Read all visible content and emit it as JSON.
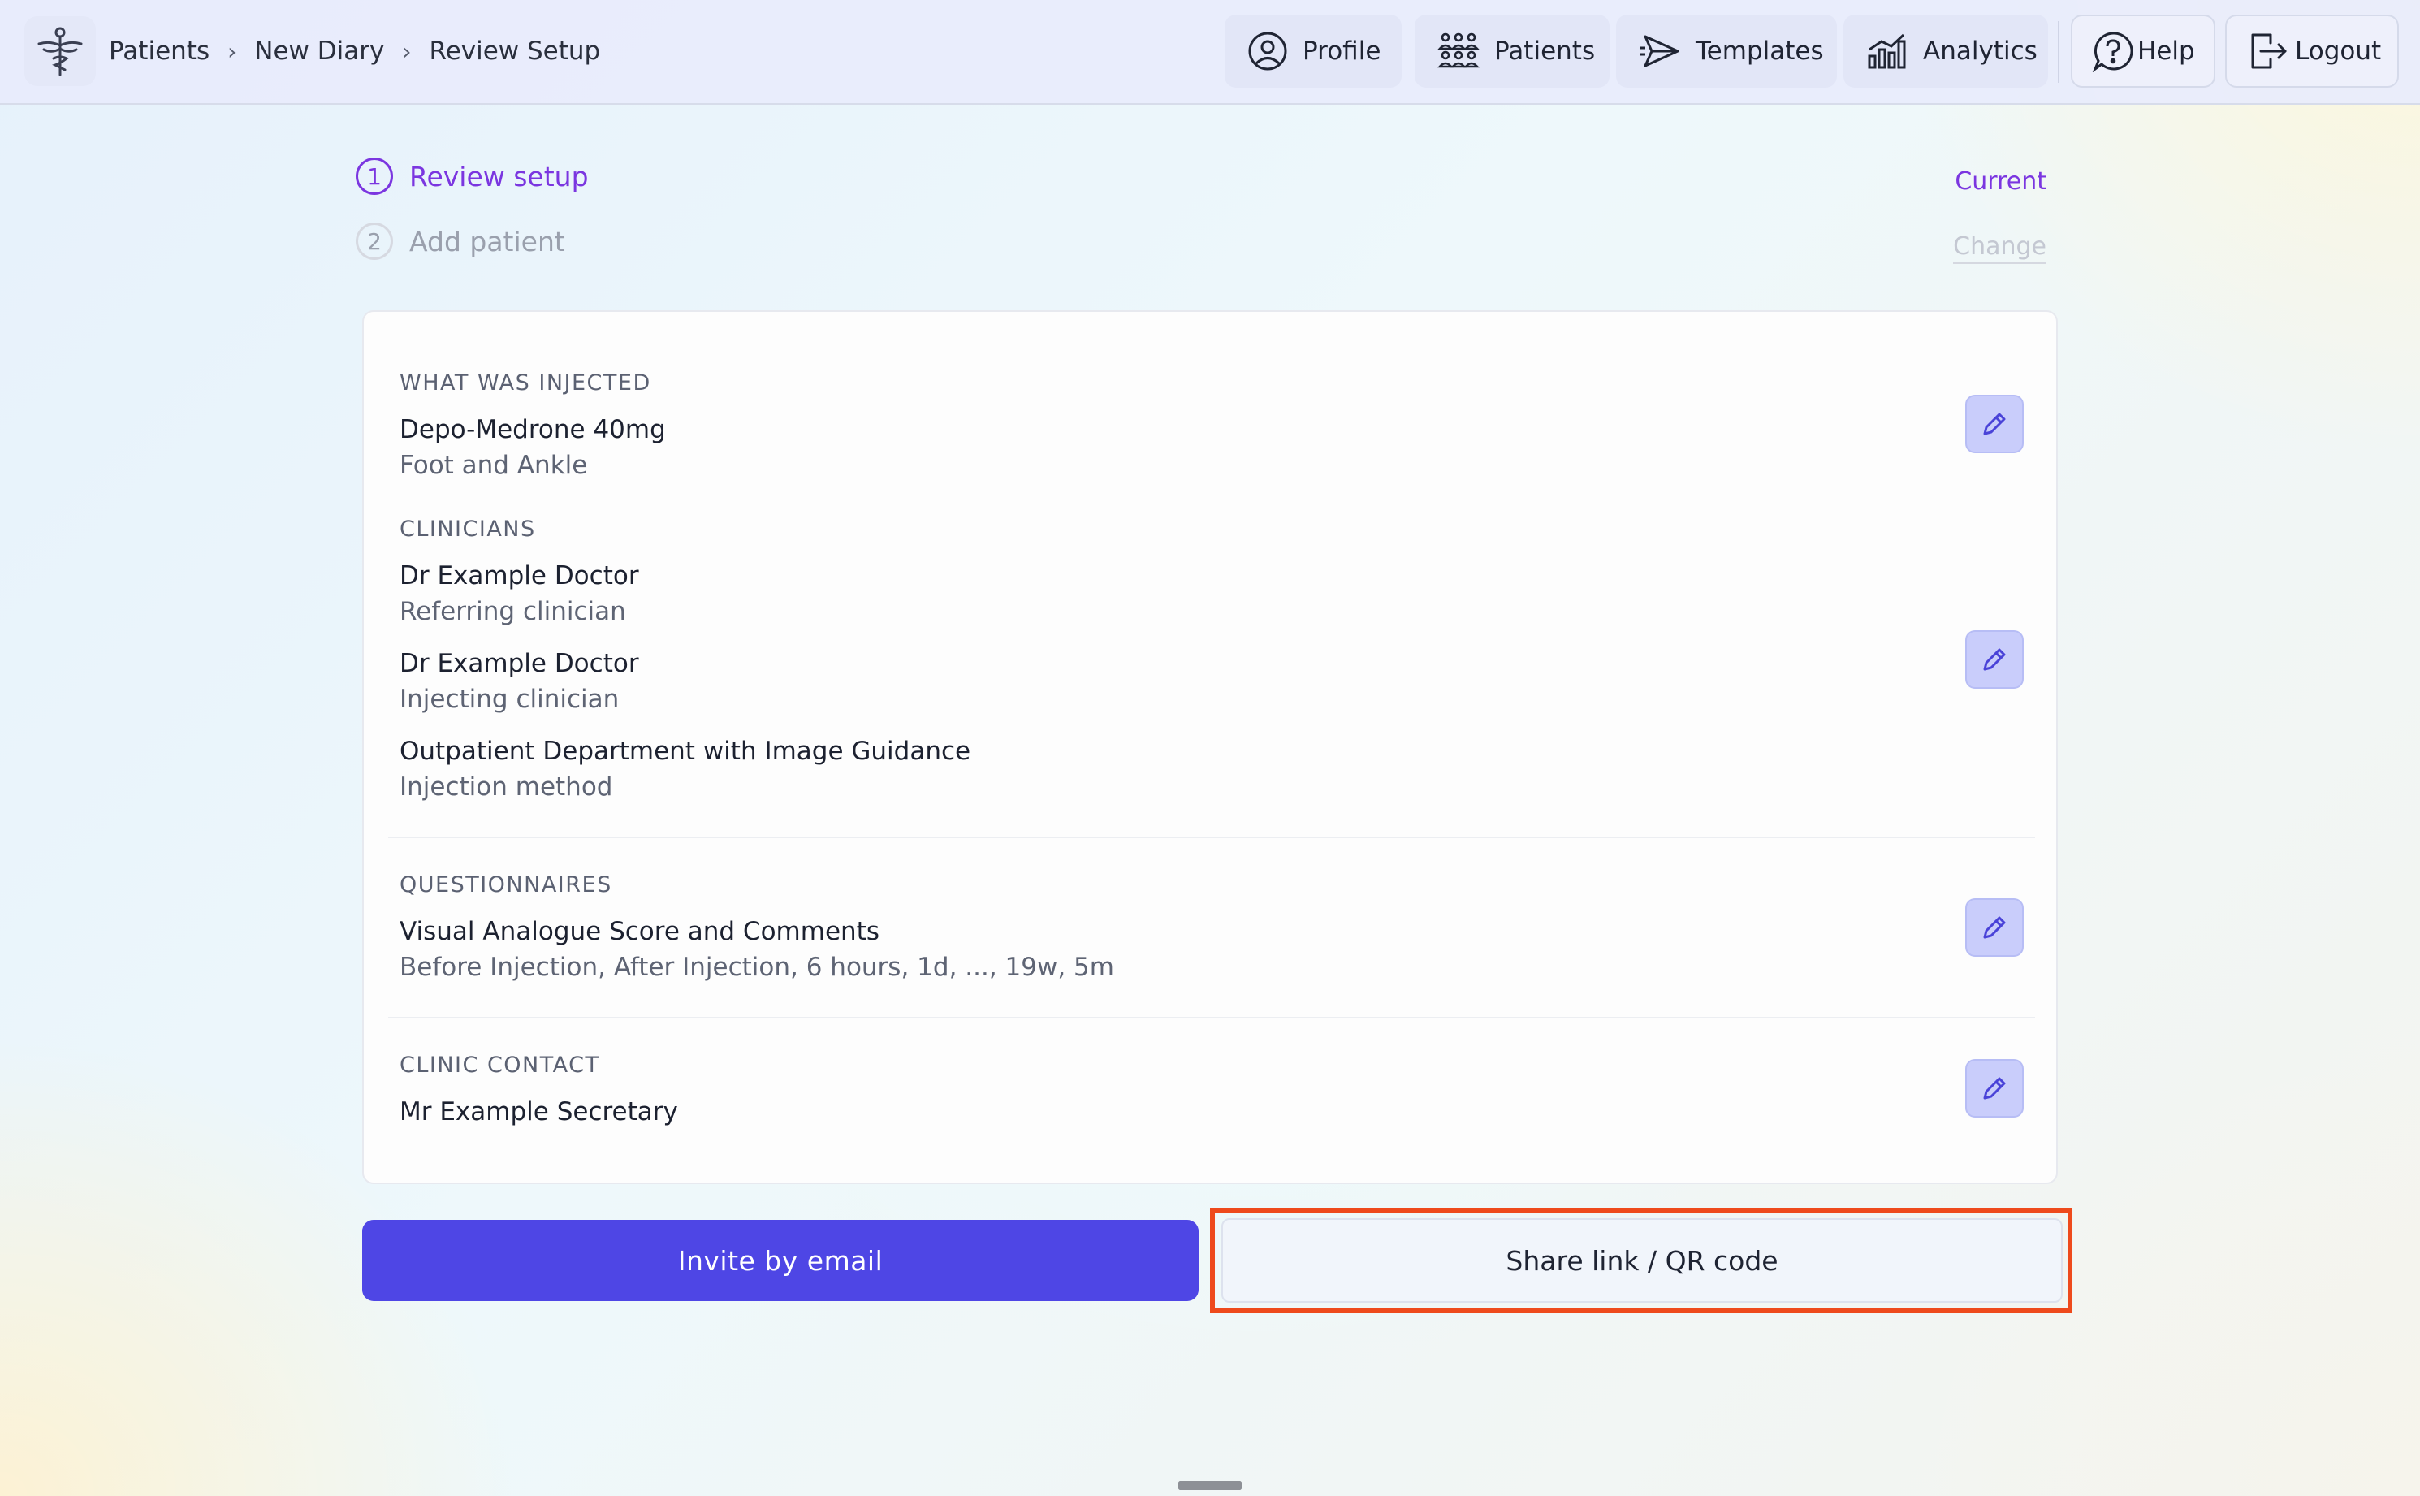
{
  "breadcrumb": [
    "Patients",
    "New Diary",
    "Review Setup"
  ],
  "nav": {
    "profile": "Profile",
    "patients": "Patients",
    "templates": "Templates",
    "analytics": "Analytics",
    "help": "Help",
    "logout": "Logout"
  },
  "steps": [
    {
      "number": "1",
      "label": "Review setup",
      "status": "Current"
    },
    {
      "number": "2",
      "label": "Add patient",
      "status": "Change"
    }
  ],
  "summary": {
    "injected": {
      "label": "WHAT WAS INJECTED",
      "drug": "Depo-Medrone 40mg",
      "site": "Foot and Ankle"
    },
    "clinicians": {
      "label": "CLINICIANS",
      "items": [
        {
          "name": "Dr Example Doctor",
          "role": "Referring clinician"
        },
        {
          "name": "Dr Example Doctor",
          "role": "Injecting clinician"
        },
        {
          "name": "Outpatient Department with Image Guidance",
          "role": "Injection method"
        }
      ]
    },
    "questionnaires": {
      "label": "QUESTIONNAIRES",
      "name": "Visual Analogue Score and Comments",
      "schedule": "Before Injection, After Injection, 6 hours, 1d, ..., 19w, 5m"
    },
    "contact": {
      "label": "CLINIC CONTACT",
      "name": "Mr Example Secretary"
    }
  },
  "actions": {
    "invite": "Invite by email",
    "share": "Share link / QR code"
  },
  "colors": {
    "accent": "#4e46e5",
    "step_active": "#7b36e0",
    "highlight": "#ee4a1c",
    "edit_bg": "#c9cdfb"
  }
}
